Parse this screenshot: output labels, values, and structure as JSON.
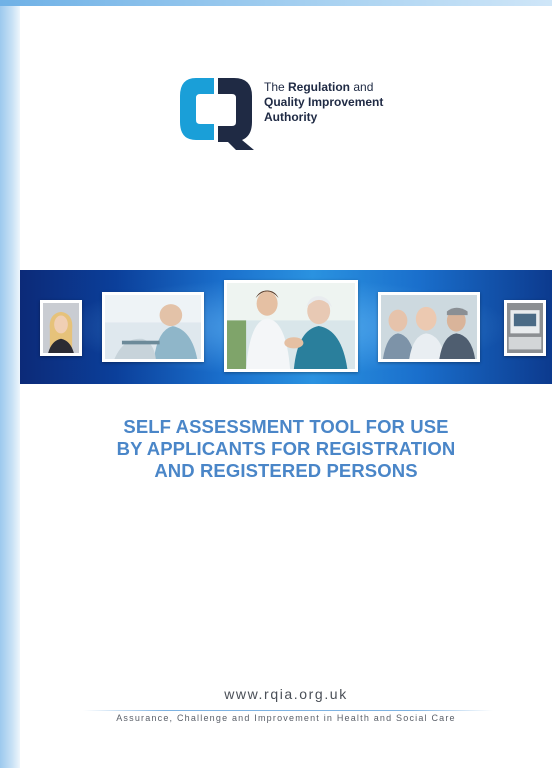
{
  "logo": {
    "line1_prefix": "The ",
    "line1_bold": "Regulation",
    "line1_suffix": " and",
    "line2_bold": "Quality Improvement",
    "line3_bold": "Authority",
    "mark_colors": {
      "c_letter": "#1a9fd8",
      "q_letter": "#1f2a44"
    }
  },
  "banner": {
    "photos": [
      {
        "name": "woman-portrait"
      },
      {
        "name": "dental-care"
      },
      {
        "name": "nurse-with-elderly-woman"
      },
      {
        "name": "elderly-men-group"
      },
      {
        "name": "medical-equipment"
      }
    ]
  },
  "title_lines": [
    "SELF ASSESSMENT TOOL FOR USE",
    "BY APPLICANTS FOR REGISTRATION",
    "AND REGISTERED PERSONS"
  ],
  "footer": {
    "url": "www.rqia.org.uk",
    "tagline": "Assurance, Challenge and Improvement in Health and Social Care"
  },
  "colors": {
    "title": "#4a86c8",
    "banner_dark": "#0c2a78",
    "banner_light": "#2a92e0"
  }
}
